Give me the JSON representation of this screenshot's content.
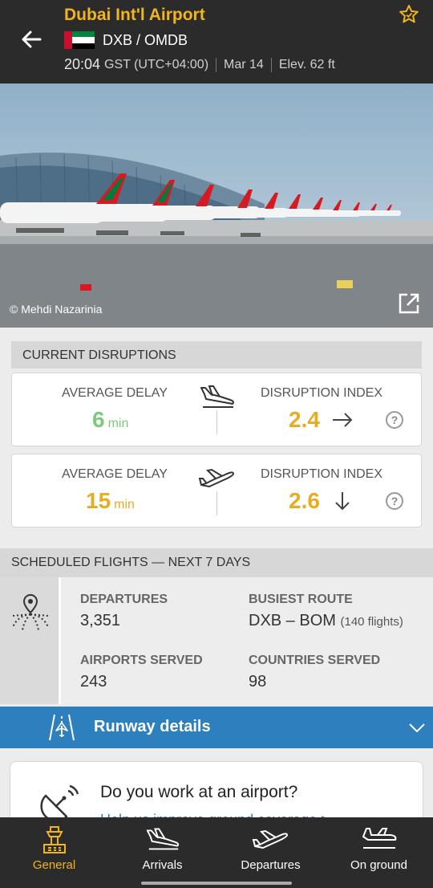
{
  "header": {
    "title": "Dubai Int'l Airport",
    "codes": "DXB / OMDB",
    "local_time": "20:04",
    "timezone": "GST (UTC+04:00)",
    "date": "Mar 14",
    "elevation": "Elev. 62 ft",
    "flag_colors": [
      "#c8102e",
      "#00843d",
      "#ffffff",
      "#000000"
    ]
  },
  "photo": {
    "credit": "© Mehdi Nazarinia"
  },
  "disruptions": {
    "section_title": "CURRENT DISRUPTIONS",
    "arrivals": {
      "avg_delay_label": "AVERAGE DELAY",
      "avg_delay_value": "6",
      "avg_delay_unit": "min",
      "avg_delay_color": "#7cc97a",
      "index_label": "DISRUPTION INDEX",
      "index_value": "2.4",
      "index_color": "#e8ac22",
      "trend": "arrow-right-icon"
    },
    "departures": {
      "avg_delay_label": "AVERAGE DELAY",
      "avg_delay_value": "15",
      "avg_delay_unit": "min",
      "avg_delay_color": "#e8ac22",
      "index_label": "DISRUPTION INDEX",
      "index_value": "2.6",
      "index_color": "#e8ac22",
      "trend": "arrow-down-icon"
    },
    "help_symbol": "?"
  },
  "scheduled": {
    "section_title": "SCHEDULED FLIGHTS — NEXT 7 DAYS",
    "departures_label": "DEPARTURES",
    "departures_value": "3,351",
    "busiest_route_label": "BUSIEST ROUTE",
    "busiest_route_value": "DXB – BOM",
    "busiest_route_flights": "(140 flights)",
    "airports_served_label": "AIRPORTS SERVED",
    "airports_served_value": "243",
    "countries_served_label": "COUNTRIES SERVED",
    "countries_served_value": "98"
  },
  "runway": {
    "label": "Runway details",
    "color": "#2e7fbe"
  },
  "work_card": {
    "title": "Do you work at an airport?",
    "link": "Help us improve ground coverage >"
  },
  "nav": {
    "items": [
      {
        "label": "General",
        "icon": "airport-tower-icon",
        "active": true
      },
      {
        "label": "Arrivals",
        "icon": "arriving-plane-icon",
        "active": false
      },
      {
        "label": "Departures",
        "icon": "departing-plane-icon",
        "active": false
      },
      {
        "label": "On ground",
        "icon": "ground-plane-icon",
        "active": false
      }
    ],
    "active_color": "#f2b51d"
  }
}
